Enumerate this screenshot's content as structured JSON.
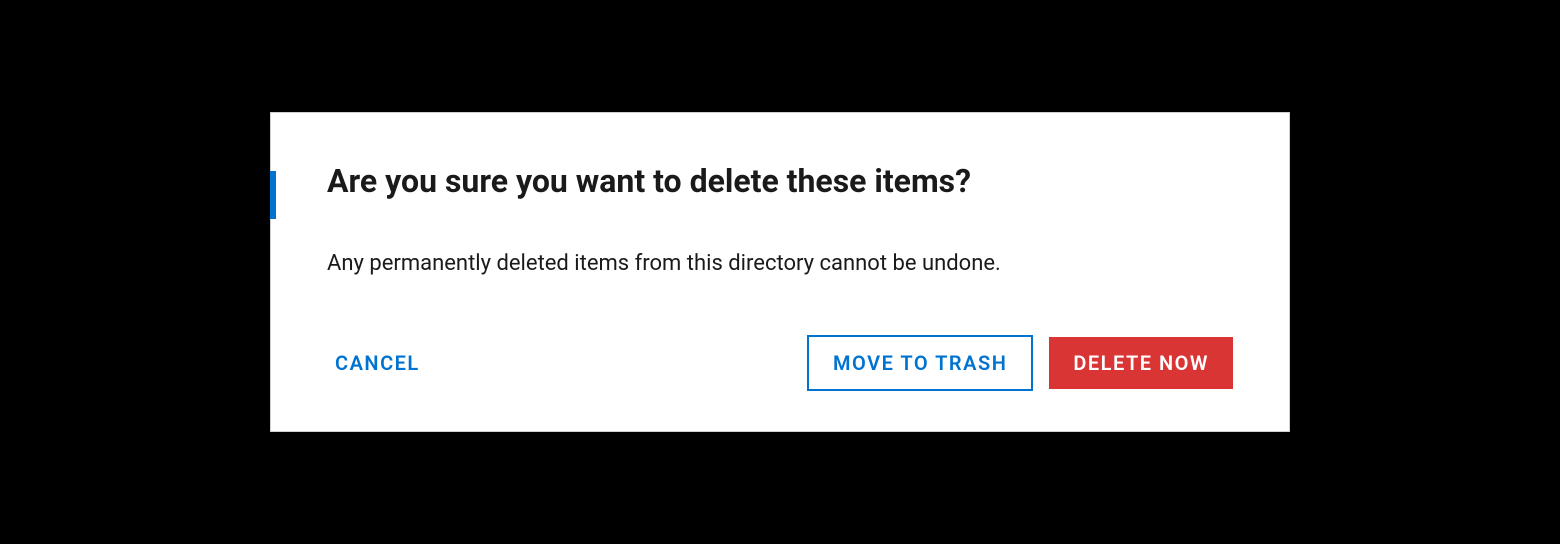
{
  "dialog": {
    "title": "Are you sure you want to delete these items?",
    "body": "Any permanently deleted items from this directory cannot be undone.",
    "actions": {
      "cancel": "Cancel",
      "move_to_trash": "Move to Trash",
      "delete_now": "Delete Now"
    }
  },
  "colors": {
    "accent": "#0073d1",
    "danger": "#d93535"
  }
}
